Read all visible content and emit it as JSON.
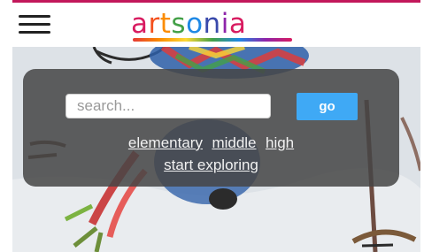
{
  "header": {
    "menu_icon": "hamburger-menu-icon",
    "logo": {
      "text": "artsonia",
      "letters": [
        {
          "char": "a",
          "color": "#d81b60"
        },
        {
          "char": "r",
          "color": "#f4511e"
        },
        {
          "char": "t",
          "color": "#fb8c00"
        },
        {
          "char": "s",
          "color": "#43a047"
        },
        {
          "char": "o",
          "color": "#1e88e5"
        },
        {
          "char": "n",
          "color": "#3949ab"
        },
        {
          "char": "i",
          "color": "#8e24aa"
        },
        {
          "char": "a",
          "color": "#d81b60"
        }
      ]
    },
    "accent_color": "#c2185b"
  },
  "search": {
    "placeholder": "search...",
    "value": "",
    "go_label": "go",
    "go_color": "#3fa9f5"
  },
  "levels": [
    {
      "label": "elementary"
    },
    {
      "label": "middle"
    },
    {
      "label": "high"
    }
  ],
  "explore_label": "start exploring"
}
